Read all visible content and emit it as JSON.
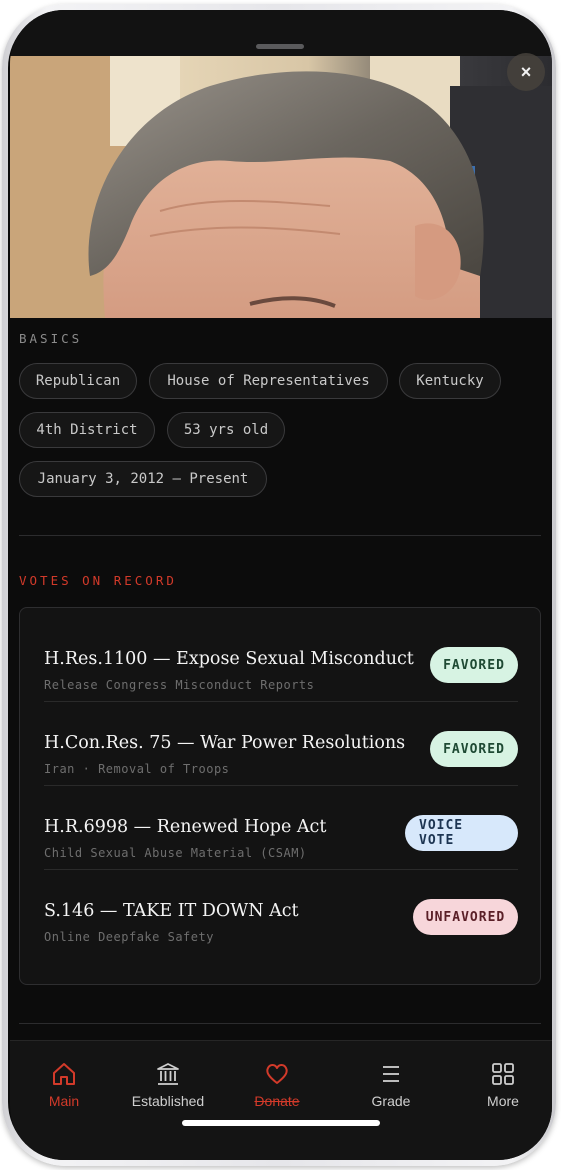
{
  "close_label": "×",
  "basics": {
    "label": "BASICS",
    "chips": [
      "Republican",
      "House of Representatives",
      "Kentucky",
      "4th District",
      "53 yrs old",
      "January 3, 2012 – Present"
    ]
  },
  "votes": {
    "label": "VOTES ON RECORD",
    "items": [
      {
        "title": "H.Res.1100 — Expose Sexual Misconduct",
        "subtitle": "Release Congress Misconduct Reports",
        "status": "FAVORED"
      },
      {
        "title": "H.Con.Res. 75 — War Power Resolutions",
        "subtitle": "Iran · Removal of Troops",
        "status": "FAVORED"
      },
      {
        "title": "H.R.6998 — Renewed Hope Act",
        "subtitle": "Child Sexual Abuse Material (CSAM)",
        "status": "VOICE VOTE"
      },
      {
        "title": "S.146 — TAKE IT DOWN Act",
        "subtitle": "Online Deepfake Safety",
        "status": "UNFAVORED"
      }
    ]
  },
  "colors": {
    "accent": "#d23a2a",
    "favored_bg": "#d7f3e3",
    "voice_bg": "#d7e8fb",
    "unfavored_bg": "#f7d6da"
  },
  "tabbar": {
    "items": [
      {
        "label": "Main",
        "icon": "home-icon",
        "active": true
      },
      {
        "label": "Established",
        "icon": "institution-icon"
      },
      {
        "label": "Donate",
        "icon": "heart-icon",
        "strikethrough": true
      },
      {
        "label": "Grade",
        "icon": "menu-icon"
      },
      {
        "label": "More",
        "icon": "grid-icon"
      }
    ]
  }
}
